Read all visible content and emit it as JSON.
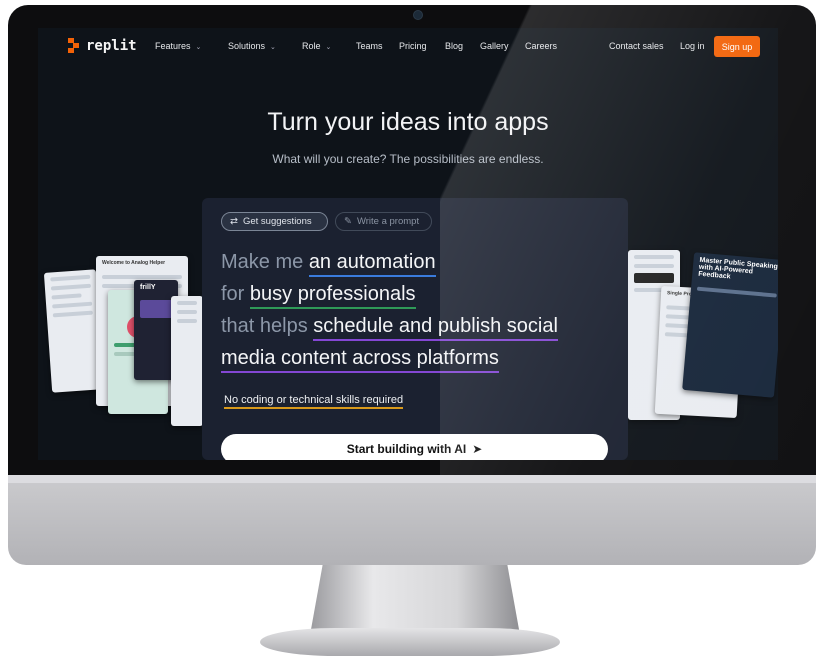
{
  "nav": {
    "logo_text": "replit",
    "items": [
      {
        "label": "Features",
        "dropdown": true
      },
      {
        "label": "Solutions",
        "dropdown": true
      },
      {
        "label": "Role",
        "dropdown": true
      },
      {
        "label": "Teams",
        "dropdown": false
      },
      {
        "label": "Pricing",
        "dropdown": false
      },
      {
        "label": "Blog",
        "dropdown": false
      },
      {
        "label": "Gallery",
        "dropdown": false
      },
      {
        "label": "Careers",
        "dropdown": false
      }
    ],
    "contact_sales": "Contact sales",
    "login": "Log in",
    "signup": "Sign up"
  },
  "hero": {
    "headline": "Turn your ideas into apps",
    "subheadline": "What will you create? The possibilities are endless."
  },
  "prompt_card": {
    "chip_suggestions": "Get suggestions",
    "chip_write": "Write a prompt",
    "line1_prefix": "Make me",
    "line1_highlight": "an automation",
    "line2_prefix": "for",
    "line2_highlight": "busy professionals",
    "line3_prefix": "that helps",
    "line3_highlight": "schedule and publish social",
    "line4_highlight": "media content across platforms",
    "no_code_note": "No coding or technical skills required",
    "cta": "Start building with AI"
  },
  "thumbnails": {
    "left_welcome": "Welcome to Analog Helper",
    "left_brand": "frillY",
    "right_title": "Master Public Speaking with AI-Powered Feedback",
    "right_listing": "Single Property Loan"
  },
  "colors": {
    "accent": "#f26207",
    "screen_bg": "#0e1319",
    "card_bg": "#1b2130",
    "underline_blue": "#3a7bdc",
    "underline_green": "#2f9a58",
    "underline_purple": "#8447d4",
    "underline_amber": "#d99a1c"
  }
}
